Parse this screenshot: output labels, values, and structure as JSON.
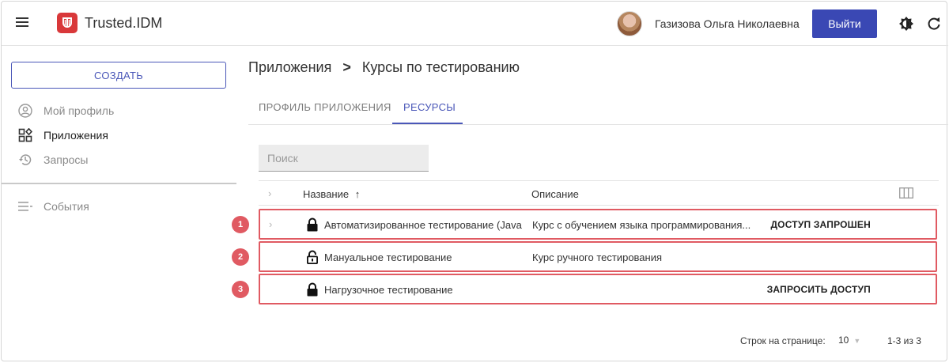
{
  "header": {
    "app_title": "Trusted.IDM",
    "user_name": "Газизова Ольга Николаевна",
    "logout_label": "Выйти",
    "accent": "#3a48b4"
  },
  "sidebar": {
    "create_label": "СОЗДАТЬ",
    "items": [
      {
        "label": "Мой профиль",
        "icon": "account-circle-icon",
        "state": "muted"
      },
      {
        "label": "Приложения",
        "icon": "apps-grid-icon",
        "state": "active"
      },
      {
        "label": "Запросы",
        "icon": "history-icon",
        "state": "muted"
      },
      {
        "label": "События",
        "icon": "list-icon",
        "state": "muted"
      }
    ]
  },
  "breadcrumb": {
    "parent": "Приложения",
    "separator": ">",
    "current": "Курсы по тестированию"
  },
  "tabs": [
    {
      "label": "ПРОФИЛЬ ПРИЛОЖЕНИЯ",
      "active": false
    },
    {
      "label": "РЕСУРСЫ",
      "active": true
    }
  ],
  "search": {
    "placeholder": "Поиск"
  },
  "table": {
    "columns": {
      "name": "Название",
      "sort_indicator": "↑",
      "description": "Описание"
    },
    "rows": [
      {
        "badge": "1",
        "lock": "locked",
        "name": "Автоматизированное тестирование (Java",
        "description": "Курс с обучением языка программирования...",
        "action": "ДОСТУП ЗАПРОШЕН",
        "expandable": true
      },
      {
        "badge": "2",
        "lock": "unlocked",
        "name": "Мануальное тестирование",
        "description": "Курс ручного тестирования",
        "action": "",
        "expandable": false
      },
      {
        "badge": "3",
        "lock": "locked",
        "name": "Нагрузочное тестирование",
        "description": "",
        "action": "ЗАПРОСИТЬ ДОСТУП",
        "expandable": false
      }
    ],
    "highlight_color": "#e05a62"
  },
  "pagination": {
    "rows_per_page_label": "Строк на странице:",
    "rows_per_page_value": "10",
    "range": "1-3 из 3"
  }
}
